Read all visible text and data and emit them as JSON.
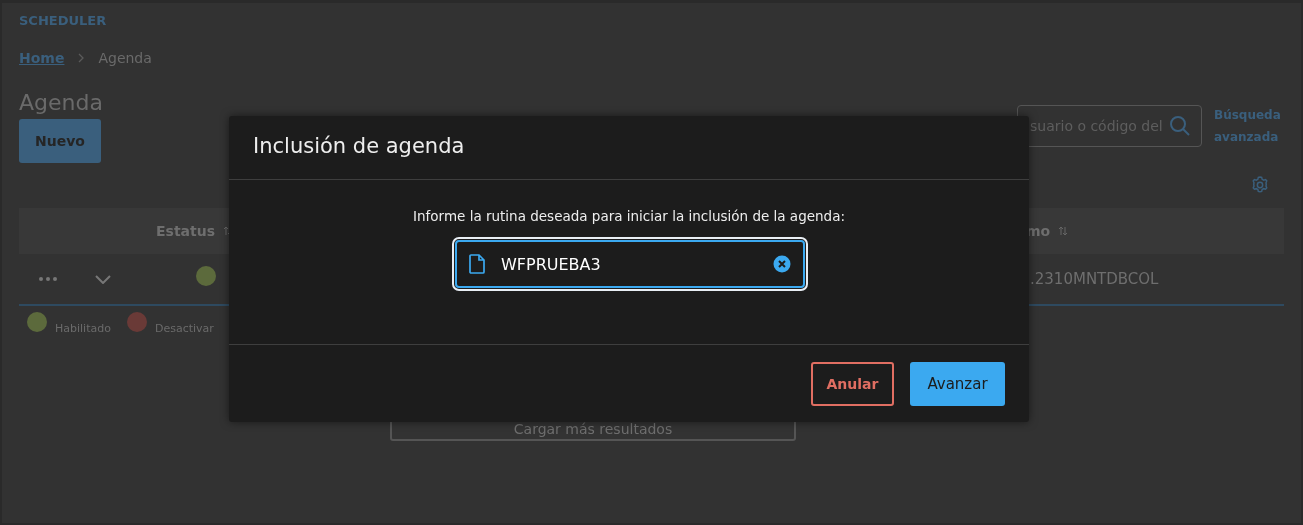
{
  "app_title": "SCHEDULER",
  "breadcrumb": [
    {
      "label": "Home",
      "kind": "link"
    },
    {
      "label": "Agenda",
      "kind": "current"
    }
  ],
  "page_title": "Agenda",
  "new_button": "Nuevo",
  "search": {
    "placeholder": "suario o código del"
  },
  "advanced_search": "Búsqueda avanzada",
  "table": {
    "columns": [
      {
        "label": "Estatus"
      },
      {
        "label": "mo"
      }
    ],
    "rows": [
      {
        "color": "#5c6a3c",
        "column_2": ".2310MNTDBCOL"
      }
    ]
  },
  "legend": [
    {
      "label": "Habilitado",
      "color": "#5c6a3c"
    },
    {
      "label": "Desactivar",
      "color": "#6a3a37"
    }
  ],
  "load_more": "Cargar más resultados",
  "modal": {
    "title": "Inclusión de agenda",
    "message": "Informe la rutina deseada para iniciar la inclusión de la agenda:",
    "field_value": "WFPRUEBA3",
    "buttons": [
      {
        "label": "Anular",
        "kind": "secondary"
      },
      {
        "label": "Avanzar",
        "kind": "primary"
      }
    ]
  }
}
